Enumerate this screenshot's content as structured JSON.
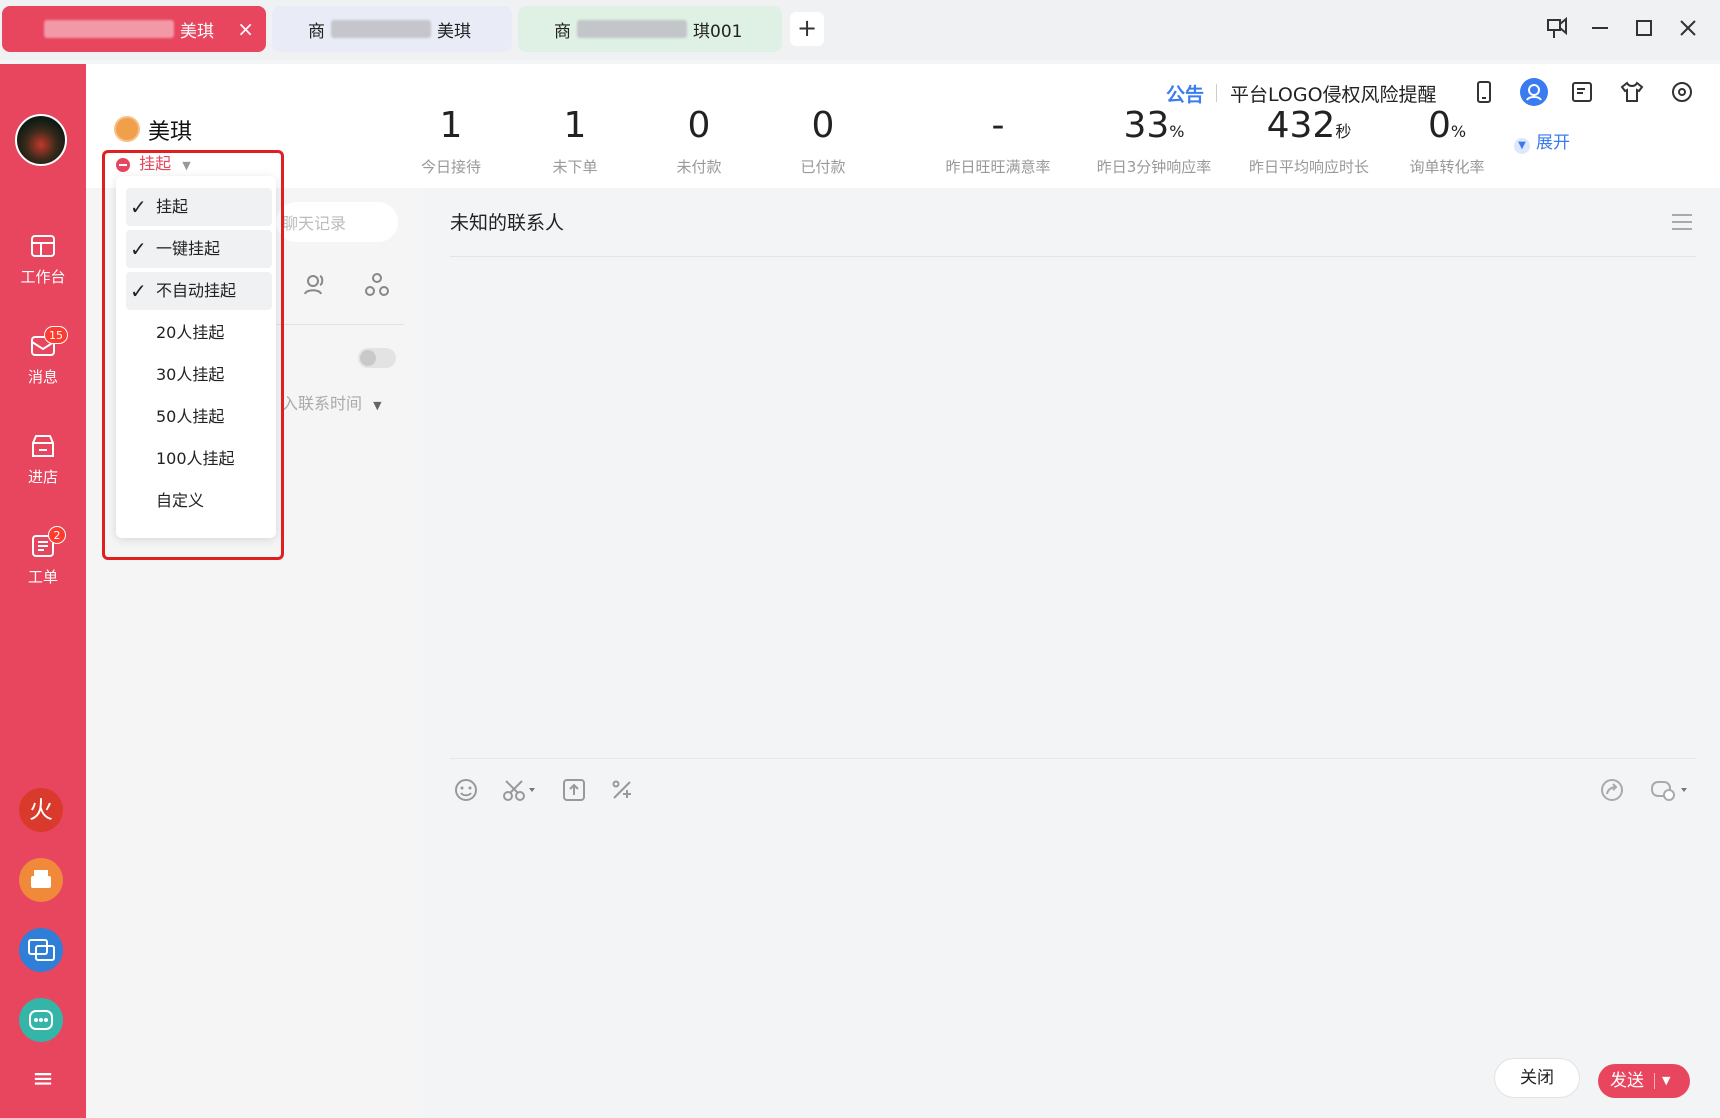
{
  "tabs": [
    {
      "label_suffix": "美琪",
      "active": true
    },
    {
      "label_prefix": "商",
      "label_suffix": "美琪"
    },
    {
      "label_prefix": "商",
      "label_suffix": "琪001"
    }
  ],
  "add_tab_label": "+",
  "sidebar": {
    "items": [
      {
        "label": "工作台",
        "icon": "workbench-icon"
      },
      {
        "label": "消息",
        "icon": "message-icon",
        "badge": "15"
      },
      {
        "label": "进店",
        "icon": "store-icon"
      },
      {
        "label": "工单",
        "icon": "ticket-icon",
        "badge": "2"
      }
    ],
    "apps": [
      "fire-app-icon",
      "printer-app-icon",
      "chat-app-icon",
      "robot-app-icon"
    ],
    "menu_icon": "≡"
  },
  "header": {
    "announcement_label": "公告",
    "announcement_text": "平台LOGO侵权风险提醒",
    "expand_label": "展开",
    "stats": [
      {
        "value": "1",
        "unit": "",
        "label": "今日接待"
      },
      {
        "value": "1",
        "unit": "",
        "label": "未下单"
      },
      {
        "value": "0",
        "unit": "",
        "label": "未付款"
      },
      {
        "value": "0",
        "unit": "",
        "label": "已付款"
      },
      {
        "value": "-",
        "unit": "",
        "label": "昨日旺旺满意率"
      },
      {
        "value": "33",
        "unit": "%",
        "label": "昨日3分钟响应率"
      },
      {
        "value": "432",
        "unit": "秒",
        "label": "昨日平均响应时长"
      },
      {
        "value": "0",
        "unit": "%",
        "label": "询单转化率"
      }
    ]
  },
  "user": {
    "name": "美琪",
    "status": "挂起"
  },
  "status_menu": {
    "items": [
      {
        "label": "挂起",
        "checked": true
      },
      {
        "label": "一键挂起",
        "checked": true
      },
      {
        "label": "不自动挂起",
        "checked": true
      },
      {
        "label": "20人挂起",
        "checked": false
      },
      {
        "label": "30人挂起",
        "checked": false
      },
      {
        "label": "50人挂起",
        "checked": false
      },
      {
        "label": "100人挂起",
        "checked": false
      },
      {
        "label": "自定义",
        "checked": false
      }
    ]
  },
  "list_panel": {
    "search_placeholder": "聊天记录",
    "sort_label": "入联系时间"
  },
  "chat": {
    "contact_title": "未知的联系人",
    "close_label": "关闭",
    "send_label": "发送"
  },
  "colors": {
    "brand": "#e8455e",
    "link": "#3a7bf0",
    "highlight": "#e02020"
  }
}
